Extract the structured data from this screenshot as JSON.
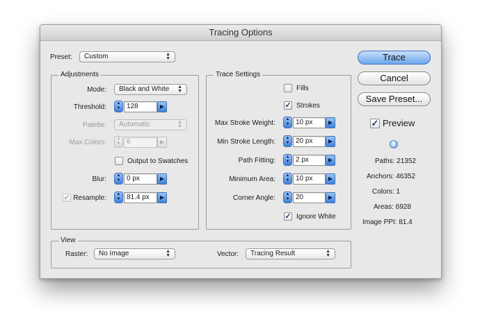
{
  "dialog": {
    "title": "Tracing Options"
  },
  "preset": {
    "label": "Preset:",
    "value": "Custom"
  },
  "adjustments": {
    "title": "Adjustments",
    "mode": {
      "label": "Mode:",
      "value": "Black and White"
    },
    "threshold": {
      "label": "Threshold:",
      "value": "128"
    },
    "palette": {
      "label": "Palette:",
      "value": "Automatic"
    },
    "max_colors": {
      "label": "Max Colors:",
      "value": "6"
    },
    "output_to_swatches": {
      "label": "Output to Swatches",
      "checked": false
    },
    "blur": {
      "label": "Blur:",
      "value": "0 px"
    },
    "resample": {
      "label": "Resample:",
      "value": "81.4 px",
      "checked": true
    }
  },
  "trace_settings": {
    "title": "Trace Settings",
    "fills": {
      "label": "Fills",
      "checked": false
    },
    "strokes": {
      "label": "Strokes",
      "checked": true
    },
    "max_stroke_weight": {
      "label": "Max Stroke Weight:",
      "value": "10 px"
    },
    "min_stroke_length": {
      "label": "Min Stroke Length:",
      "value": "20 px"
    },
    "path_fitting": {
      "label": "Path Fitting:",
      "value": "2 px"
    },
    "minimum_area": {
      "label": "Minimum Area:",
      "value": "10 px"
    },
    "corner_angle": {
      "label": "Corner Angle:",
      "value": "20"
    },
    "ignore_white": {
      "label": "Ignore White",
      "checked": true
    }
  },
  "view": {
    "title": "View",
    "raster": {
      "label": "Raster:",
      "value": "No Image"
    },
    "vector": {
      "label": "Vector:",
      "value": "Tracing Result"
    }
  },
  "buttons": {
    "trace": "Trace",
    "cancel": "Cancel",
    "save_preset": "Save Preset..."
  },
  "preview": {
    "label": "Preview",
    "checked": true
  },
  "stats": {
    "paths": "Paths: 21352",
    "anchors": "Anchors: 46352",
    "colors": "Colors: 1",
    "areas": "Areas: 6928",
    "image_ppi": "Image PPI: 81.4"
  },
  "icons": {
    "check": "check-icon",
    "popup_arrows": "updown-arrows-icon",
    "stepper": "stepper-arrows-icon",
    "flyout": "triangle-right-icon",
    "info": "info-icon"
  },
  "colors": {
    "accent": "#6ea7ec",
    "stepper_blue": "#3f82da",
    "dialog_bg": "#e8e8e8"
  }
}
